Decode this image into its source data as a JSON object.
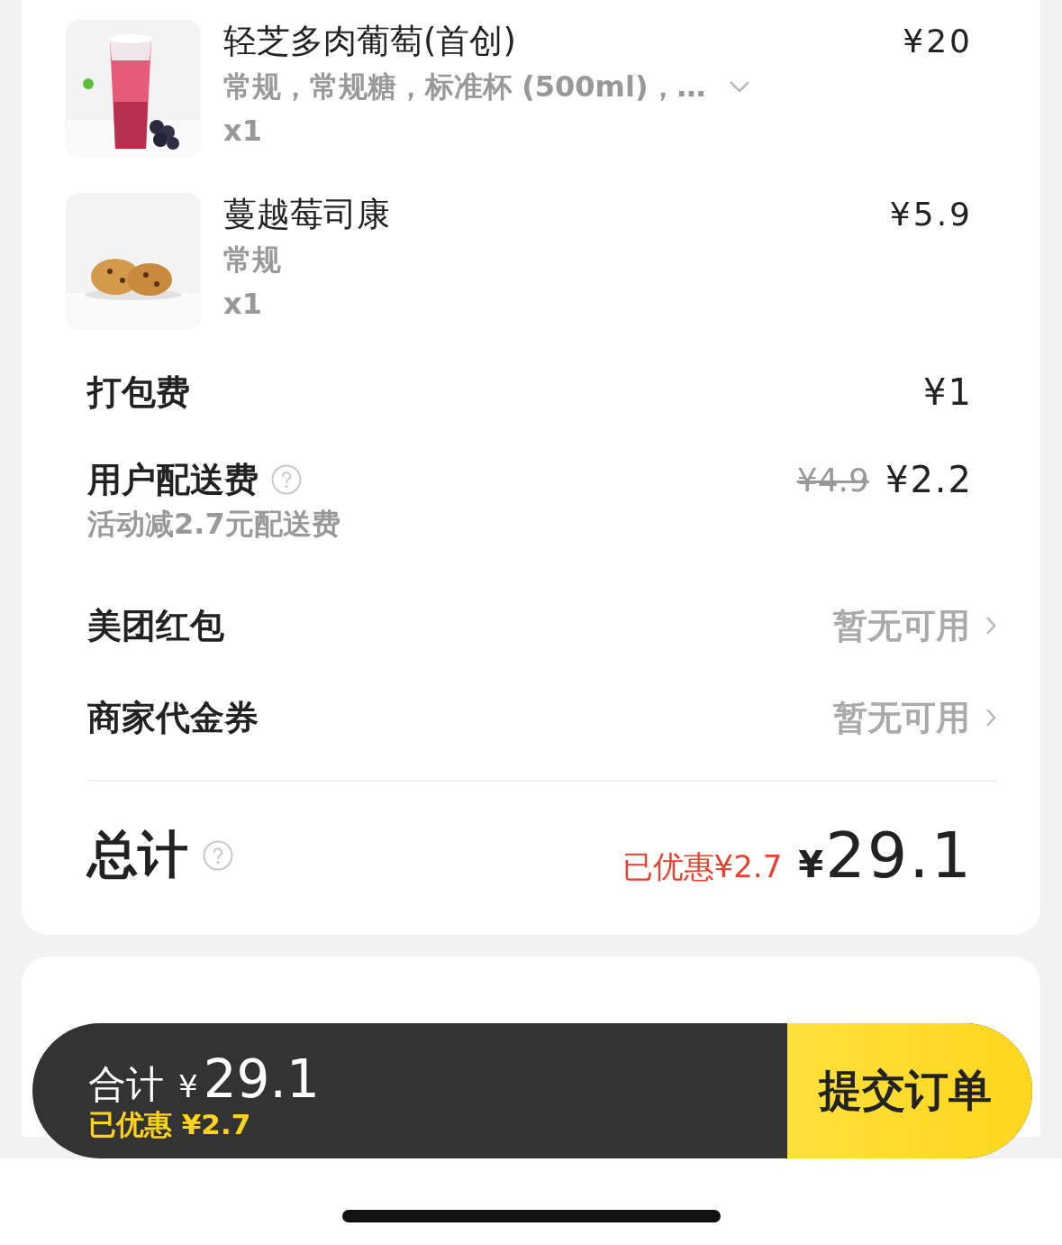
{
  "items": [
    {
      "name": "轻芝多肉葡萄(首创)",
      "specs": "常规，常规糖，标准杯 (500ml)，…",
      "expandable": true,
      "quantity": "x1",
      "price": "¥20"
    },
    {
      "name": "蔓越莓司康",
      "specs": "常规",
      "expandable": false,
      "quantity": "x1",
      "price": "¥5.9"
    }
  ],
  "fees": [
    {
      "label": "打包费",
      "help": false,
      "price": "¥1"
    },
    {
      "label": "用户配送费",
      "help": true,
      "original_price": "¥4.9",
      "price": "¥2.2",
      "note": "活动减2.7元配送费"
    }
  ],
  "coupons": [
    {
      "label": "美团红包",
      "value": "暂无可用"
    },
    {
      "label": "商家代金券",
      "value": "暂无可用"
    }
  ],
  "total": {
    "label": "总计",
    "help": true,
    "discount": "已优惠¥2.7",
    "currency": "¥",
    "amount": "29.1"
  },
  "checkout": {
    "label": "合计",
    "currency": "¥",
    "amount": "29.1",
    "saved": "已优惠 ¥2.7",
    "submit": "提交订单"
  }
}
